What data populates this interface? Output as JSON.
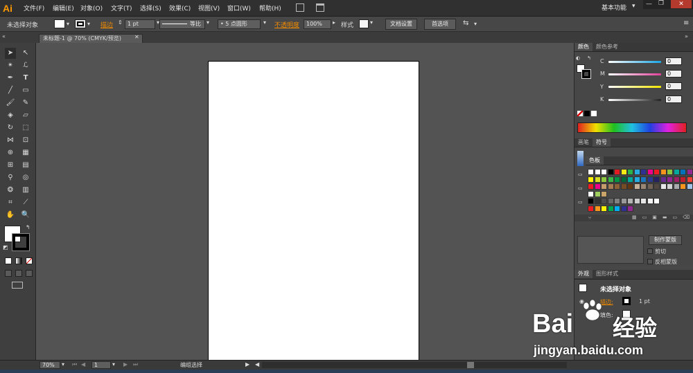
{
  "app": {
    "logo": "Ai",
    "workspace": "基本功能"
  },
  "menu": [
    "文件(F)",
    "编辑(E)",
    "对象(O)",
    "文字(T)",
    "选择(S)",
    "效果(C)",
    "视图(V)",
    "窗口(W)",
    "帮助(H)"
  ],
  "control": {
    "selection": "未选择对象",
    "stroke_label": "描边",
    "stroke_weight": "1 pt",
    "profile": "等比",
    "brush": "5 点圆形",
    "opacity_label": "不透明度",
    "opacity": "100%",
    "style_label": "样式",
    "doc_setup": "文档设置",
    "preferences": "首选项"
  },
  "document": {
    "tab": "未标题-1 @ 70% (CMYK/预览)"
  },
  "status": {
    "zoom": "70%",
    "page": "1",
    "tool": "编组选择"
  },
  "color_panel": {
    "tabs": [
      "颜色",
      "颜色参考"
    ],
    "channels": [
      {
        "label": "C",
        "value": "0",
        "color": "#1aa7e6"
      },
      {
        "label": "M",
        "value": "0",
        "color": "#e0409a"
      },
      {
        "label": "Y",
        "value": "0",
        "color": "#f2e600"
      },
      {
        "label": "K",
        "value": "0",
        "color": "#222222"
      }
    ]
  },
  "swatch_panel": {
    "tabs": [
      "画笔",
      "符号"
    ],
    "title": "色板"
  },
  "transparency_panel": {
    "make_mask": "制作蒙版",
    "clip": "剪切",
    "invert": "反相蒙版"
  },
  "appearance_panel": {
    "tabs": [
      "外观",
      "图形样式"
    ],
    "object": "未选择对象",
    "stroke_label": "描边:",
    "stroke_value": "1 pt",
    "fill_label": "填色:"
  },
  "watermark": {
    "brand": "Bai",
    "brand2": "经验",
    "url": "jingyan.baidu.com"
  }
}
